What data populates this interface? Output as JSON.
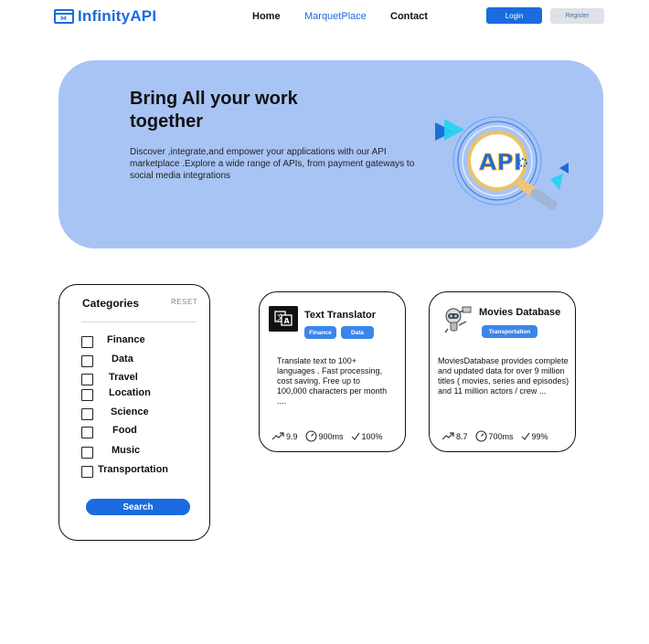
{
  "header": {
    "logo_text": "InfinityAPI",
    "nav": [
      "Home",
      "MarquetPlace",
      "Contact"
    ],
    "login_label": "Login",
    "register_label": "Register"
  },
  "hero": {
    "title": "Bring All your work together",
    "description": "Discover ,integrate,and empower your applications with our API marketplace .Explore a wide range of APIs, from payment gateways to social media integrations",
    "art_text": "API"
  },
  "categories": {
    "title": "Categories",
    "reset_label": "RESET",
    "items": [
      "Finance",
      "Data",
      "Travel",
      "Location",
      "Science",
      "Food",
      "Music",
      "Transportation"
    ],
    "search_label": "Search"
  },
  "apis": [
    {
      "title": "Text Translator",
      "tags": [
        "Finance",
        "Data"
      ],
      "description": "Translate text to 100+ languages . Fast processing, cost saving. Free up to 100,000 characters per month ....",
      "popularity": "9.9",
      "latency": "900ms",
      "success": "100%"
    },
    {
      "title": "Movies Database",
      "tags": [
        "Transportation"
      ],
      "description": "MoviesDatabase provides complete and updated data for over 9 million titles ( movies, series and episodes) and 11 million actors / crew ...",
      "popularity": "8.7",
      "latency": "700ms",
      "success": "99%"
    }
  ],
  "colors": {
    "brand": "#1a6be0",
    "hero_bg": "#a8c4f5",
    "tag": "#3a86e8"
  }
}
